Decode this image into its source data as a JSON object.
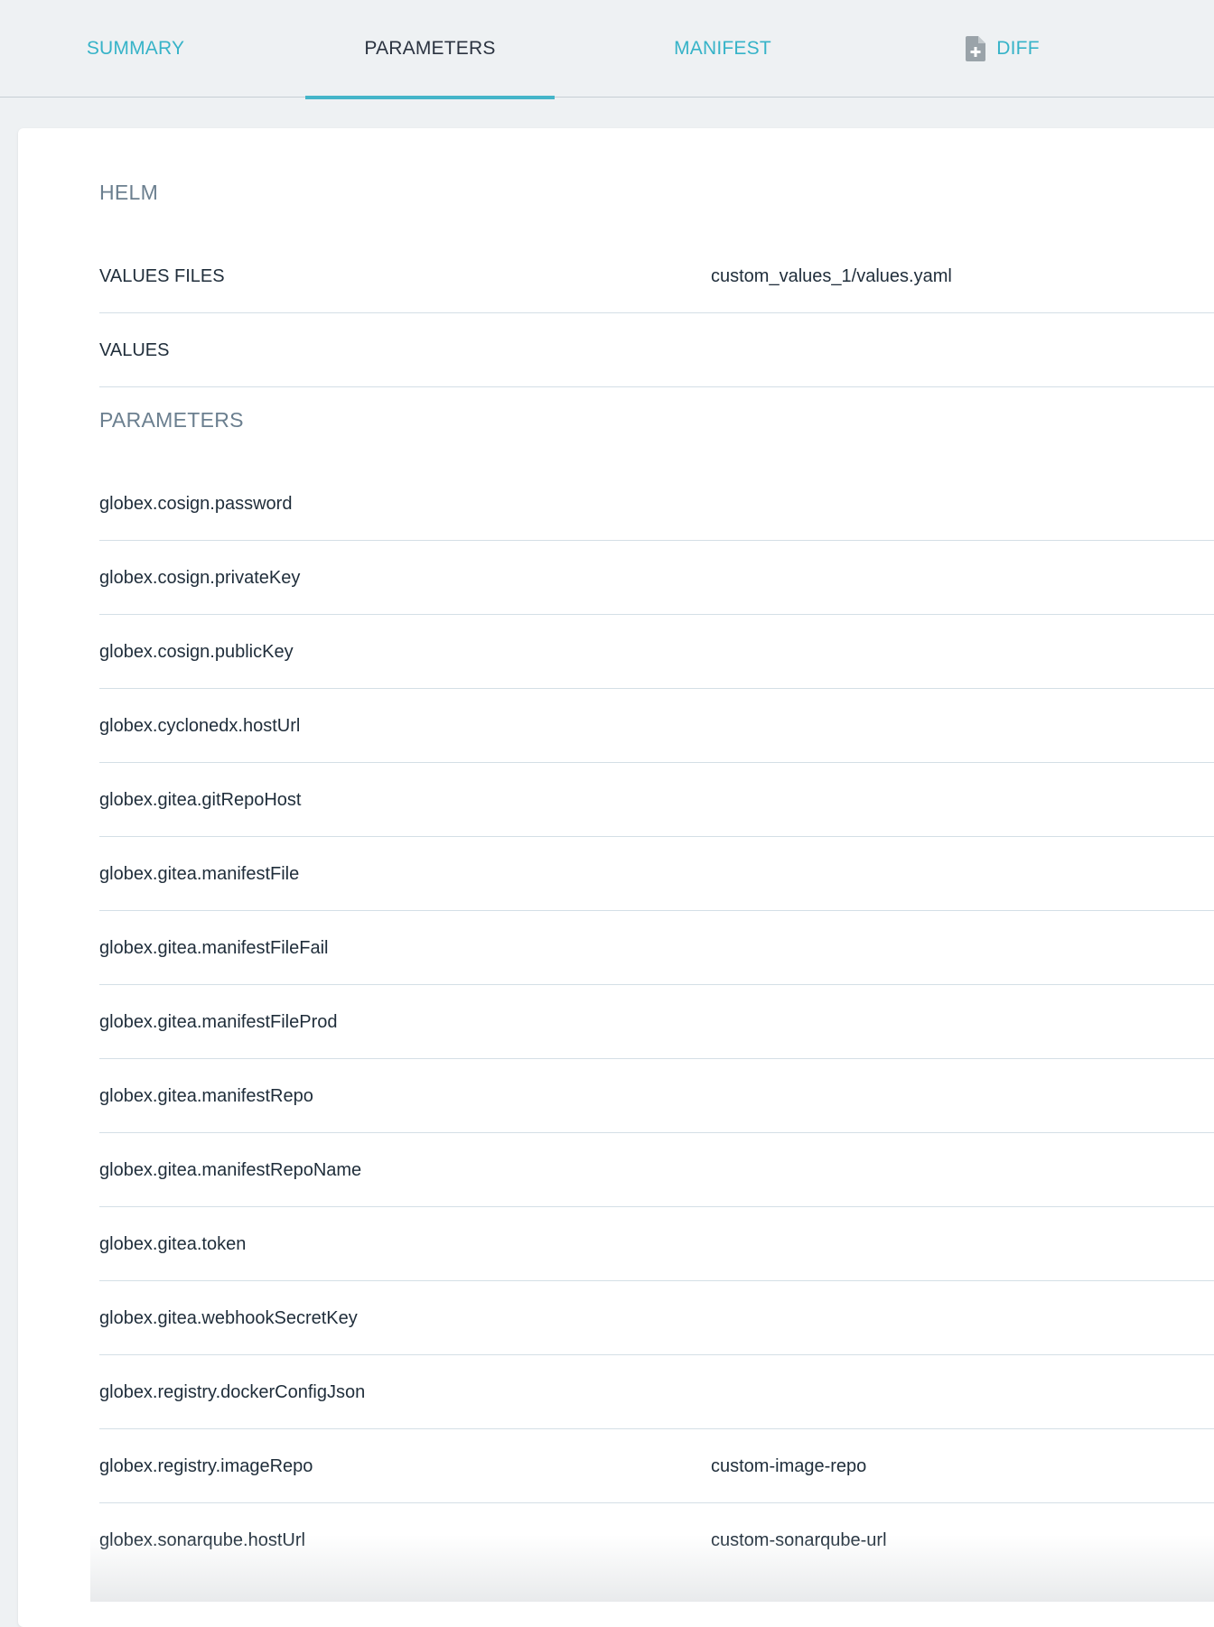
{
  "tabs": [
    {
      "label": "SUMMARY",
      "active": false
    },
    {
      "label": "PARAMETERS",
      "active": true
    },
    {
      "label": "MANIFEST",
      "active": false
    },
    {
      "label": "DIFF",
      "active": false,
      "icon": "file-plus-icon"
    }
  ],
  "helm": {
    "title": "HELM",
    "rows": [
      {
        "key": "VALUES FILES",
        "value": "custom_values_1/values.yaml"
      },
      {
        "key": "VALUES",
        "value": ""
      }
    ]
  },
  "parameters": {
    "title": "PARAMETERS",
    "rows": [
      {
        "key": "globex.cosign.password",
        "value": ""
      },
      {
        "key": "globex.cosign.privateKey",
        "value": ""
      },
      {
        "key": "globex.cosign.publicKey",
        "value": ""
      },
      {
        "key": "globex.cyclonedx.hostUrl",
        "value": ""
      },
      {
        "key": "globex.gitea.gitRepoHost",
        "value": ""
      },
      {
        "key": "globex.gitea.manifestFile",
        "value": ""
      },
      {
        "key": "globex.gitea.manifestFileFail",
        "value": ""
      },
      {
        "key": "globex.gitea.manifestFileProd",
        "value": ""
      },
      {
        "key": "globex.gitea.manifestRepo",
        "value": ""
      },
      {
        "key": "globex.gitea.manifestRepoName",
        "value": ""
      },
      {
        "key": "globex.gitea.token",
        "value": ""
      },
      {
        "key": "globex.gitea.webhookSecretKey",
        "value": ""
      },
      {
        "key": "globex.registry.dockerConfigJson",
        "value": ""
      },
      {
        "key": "globex.registry.imageRepo",
        "value": "custom-image-repo"
      },
      {
        "key": "globex.sonarqube.hostUrl",
        "value": "custom-sonarqube-url"
      }
    ]
  },
  "colors": {
    "accent": "#36b3c8",
    "active_tab_text": "#2b3340",
    "section_title": "#6b7f8f",
    "divider": "#d4dfe6"
  }
}
